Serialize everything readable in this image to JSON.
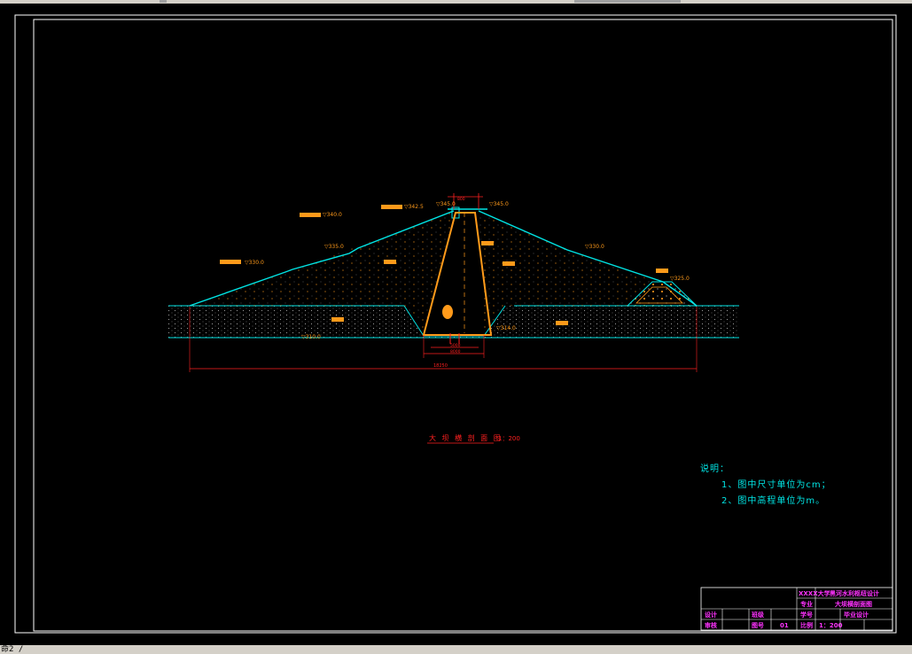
{
  "drawing": {
    "section_title": "大 坝 横 剖 面 图",
    "section_scale": "1：200",
    "notes_heading": "说明：",
    "notes": [
      "1、图中尺寸单位为cm；",
      "2、图中高程单位为m。"
    ],
    "elevations": {
      "crest": "▽345.0",
      "crest_right": "▽345.0",
      "upstream_upper": "▽342.5",
      "upstream_mid": "▽340.0",
      "upstream_low": "▽335.0",
      "upstream_toe": "▽330.0",
      "downstream_mid": "▽330.0",
      "downstream_berm": "▽325.0",
      "core_base": "▽314.0",
      "base": "▽310.0"
    },
    "dims": {
      "overall_width": "18250",
      "core_base_w1": "5000",
      "core_base_w2": "8000",
      "crest_w": "800"
    },
    "title_block": {
      "school": "XXXX大学",
      "project": "黑河水利枢纽设计",
      "drawing_name": "大坝横剖面图",
      "major": "专业",
      "design_label": "设计",
      "check_label": "审核",
      "class_label": "班级",
      "student_no_label": "学号",
      "drawing_no_label": "图号",
      "drawing_no": "01",
      "scale_label": "比例",
      "scale": "1：200",
      "graduation": "毕业设计"
    }
  },
  "status": {
    "command_line": "命2 /"
  },
  "colors": {
    "background": "#000000",
    "frame": "#ffffff",
    "slope_line": "#00e5e5",
    "core": "#ff9a1a",
    "dimension": "#ff2020",
    "title_block_text": "#ff33ff"
  }
}
